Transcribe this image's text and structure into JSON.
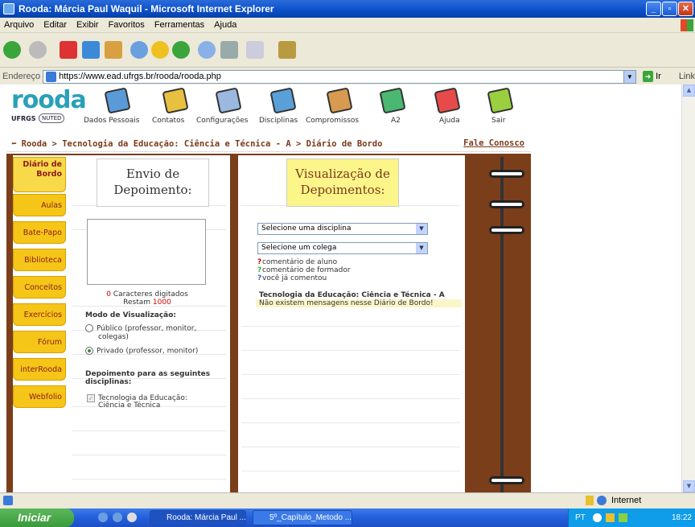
{
  "window": {
    "title": "Rooda: Márcia Paul Waquil - Microsoft Internet Explorer"
  },
  "menu": [
    "Arquivo",
    "Editar",
    "Exibir",
    "Favoritos",
    "Ferramentas",
    "Ajuda"
  ],
  "address": {
    "label": "Endereço",
    "url": "https://www.ead.ufrgs.br/rooda/rooda.php",
    "go": "Ir",
    "links": "Link"
  },
  "header": {
    "logo": "rooda",
    "ufrgs": "UFRGS",
    "nuted": "NUTED",
    "nav": [
      "Dados Pessoais",
      "Contatos",
      "Configurações",
      "Disciplinas",
      "Compromissos",
      "A2",
      "Ajuda",
      "Sair"
    ]
  },
  "breadcrumb": {
    "text": "Rooda > Tecnologia da Educação: Ciência e Técnica - A > Diário de Bordo",
    "contact": "Fale Conosco"
  },
  "tabs": [
    "Diário de Bordo",
    "Aulas",
    "Bate-Papo",
    "Biblioteca",
    "Conceitos",
    "Exercícios",
    "Fórum",
    "interRooda",
    "Webfolio"
  ],
  "left": {
    "title_line1": "Envio de",
    "title_line2": "Depoimento:",
    "chars_count": "0",
    "chars_label": "Caracteres digitados",
    "remaining_label": "Restam",
    "remaining_count": "1000",
    "mode_label": "Modo de Visualização:",
    "option_public_1": "Público (professor, monitor,",
    "option_public_2": "colegas)",
    "option_private": "Privado (professor, monitor)",
    "disc_label_1": "Depoimento para as seguintes",
    "disc_label_2": "disciplinas:",
    "disc_item_1": "Tecnologia da Educação:",
    "disc_item_2": "Ciência e Técnica"
  },
  "right": {
    "title_line1": "Visualização de",
    "title_line2": "Depoimentos:",
    "select_discipline": "Selecione uma disciplina",
    "select_colleague": "Selecione um colega",
    "legend_student": "comentário de aluno",
    "legend_teacher": "comentário de formador",
    "legend_you": "você já comentou",
    "course_heading": "Tecnologia da Educação: Ciência e Técnica - A",
    "no_messages": "Não existem mensagens nesse Diário de Bordo!"
  },
  "status": {
    "zone": "Internet"
  },
  "taskbar": {
    "start": "Iniciar",
    "tasks": [
      "Rooda: Márcia Paul ...",
      "5º_Capítulo_Metodo ..."
    ],
    "lang": "PT",
    "time": "18:22"
  }
}
